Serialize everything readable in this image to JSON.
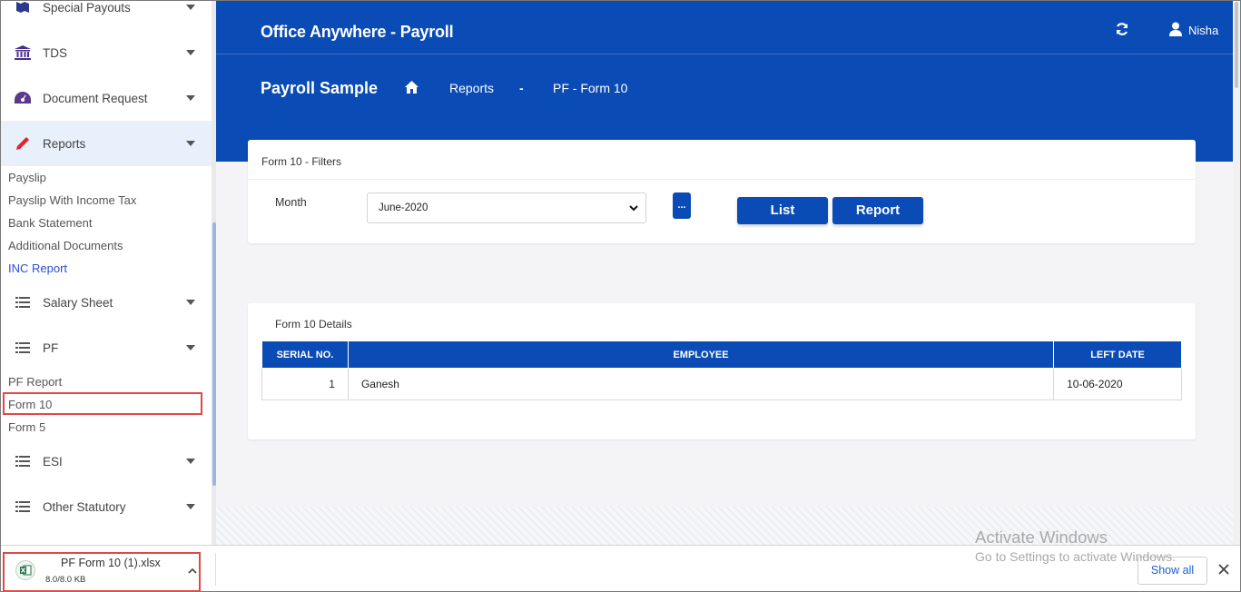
{
  "sidebar": {
    "menu": [
      {
        "label": "Special Payouts",
        "icon": "flag-icon"
      },
      {
        "label": "TDS",
        "icon": "bank-icon"
      },
      {
        "label": "Document Request",
        "icon": "dashboard-icon"
      },
      {
        "label": "Reports",
        "icon": "pencil-icon"
      },
      {
        "label": "Salary Sheet",
        "icon": "list-icon"
      },
      {
        "label": "PF",
        "icon": "list-icon"
      },
      {
        "label": "ESI",
        "icon": "list-icon"
      },
      {
        "label": "Other Statutory",
        "icon": "list-icon"
      }
    ],
    "reports_sub": [
      "Payslip",
      "Payslip With Income Tax",
      "Bank Statement",
      "Additional Documents",
      "INC Report"
    ],
    "pf_sub": [
      "PF Report",
      "Form 10",
      "Form 5"
    ]
  },
  "header": {
    "app_title": "Office Anywhere - Payroll",
    "user": "Nisha"
  },
  "breadcrumb": {
    "title": "Payroll Sample",
    "items": [
      "Reports",
      "-",
      "PF - Form 10"
    ]
  },
  "filters": {
    "title": "Form 10 - Filters",
    "month_label": "Month",
    "month_value": "June-2020",
    "dots_label": "...",
    "list_label": "List",
    "report_label": "Report"
  },
  "details": {
    "title": "Form 10 Details",
    "columns": [
      "SERIAL NO.",
      "EMPLOYEE",
      "LEFT DATE"
    ],
    "rows": [
      [
        "1",
        "Ganesh",
        "10-06-2020"
      ]
    ]
  },
  "download": {
    "file_name": "PF Form 10 (1).xlsx",
    "size": "8.0/8.0 KB",
    "show_all": "Show all"
  },
  "watermark": {
    "line1": "Activate Windows",
    "line2": "Go to Settings to activate Windows."
  },
  "colors": {
    "primary": "#0a4bb5",
    "highlight": "#e04848"
  }
}
